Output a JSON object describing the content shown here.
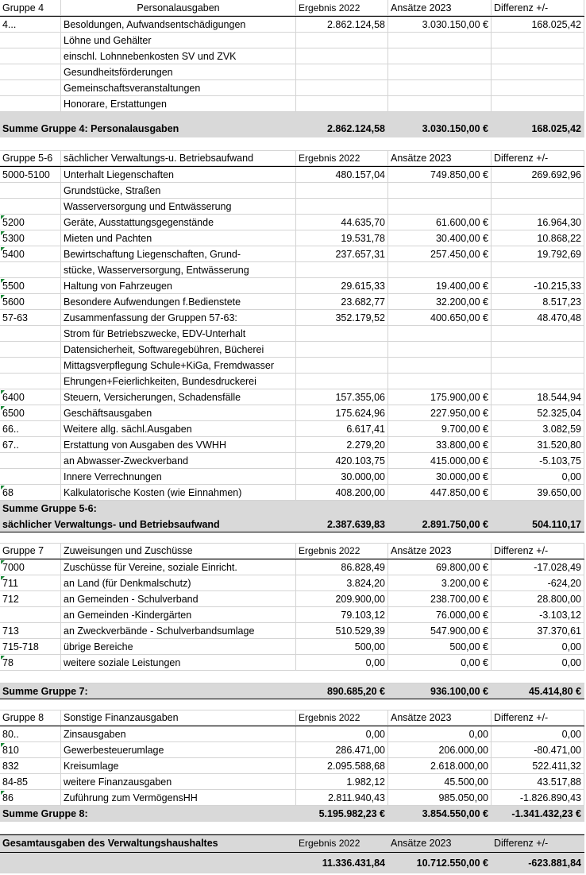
{
  "columns": {
    "ergebnis": "Ergebnis 2022",
    "ansaetze": "Ansätze 2023",
    "differenz": "Differenz +/-"
  },
  "g4": {
    "label": "Gruppe 4",
    "title": "Personalausgaben",
    "rows": [
      {
        "code": "4...",
        "desc": "Besoldungen, Aufwandsentschädigungen",
        "e": "2.862.124,58",
        "a": "3.030.150,00 €",
        "d": "168.025,42"
      },
      {
        "code": "",
        "desc": "Löhne und Gehälter",
        "e": "",
        "a": "",
        "d": ""
      },
      {
        "code": "",
        "desc": "einschl. Lohnnebenkosten SV und ZVK",
        "e": "",
        "a": "",
        "d": ""
      },
      {
        "code": "",
        "desc": "Gesundheitsförderungen",
        "e": "",
        "a": "",
        "d": ""
      },
      {
        "code": "",
        "desc": "Gemeinschaftsveranstaltungen",
        "e": "",
        "a": "",
        "d": ""
      },
      {
        "code": "",
        "desc": "Honorare, Erstattungen",
        "e": "",
        "a": "",
        "d": ""
      }
    ],
    "sum": {
      "label": "Summe Gruppe 4: Personalausgaben",
      "e": "2.862.124,58",
      "a": "3.030.150,00 €",
      "d": "168.025,42"
    }
  },
  "g56": {
    "label": "Gruppe 5-6",
    "title": "sächlicher Verwaltungs-u. Betriebsaufwand",
    "rows": [
      {
        "code": "5000-5100",
        "desc": "Unterhalt Liegenschaften",
        "e": "480.157,04",
        "a": "749.850,00 €",
        "d": "269.692,96"
      },
      {
        "code": "",
        "desc": "Grundstücke, Straßen",
        "e": "",
        "a": "",
        "d": ""
      },
      {
        "code": "",
        "desc": "Wasserversorgung und Entwässerung",
        "e": "",
        "a": "",
        "d": ""
      },
      {
        "code": "5200",
        "desc": "Geräte, Ausstattungsgegenstände",
        "e": "44.635,70",
        "a": "61.600,00 €",
        "d": "16.964,30"
      },
      {
        "code": "5300",
        "desc": "Mieten und Pachten",
        "e": "19.531,78",
        "a": "30.400,00 €",
        "d": "10.868,22"
      },
      {
        "code": "5400",
        "desc": "Bewirtschaftung Liegenschaften, Grund-",
        "e": "237.657,31",
        "a": "257.450,00 €",
        "d": "19.792,69"
      },
      {
        "code": "",
        "desc": "stücke, Wasserversorgung, Entwässerung",
        "e": "",
        "a": "",
        "d": ""
      },
      {
        "code": "5500",
        "desc": "Haltung von Fahrzeugen",
        "e": "29.615,33",
        "a": "19.400,00 €",
        "d": "-10.215,33"
      },
      {
        "code": "5600",
        "desc": "Besondere Aufwendungen f.Bedienstete",
        "e": "23.682,77",
        "a": "32.200,00 €",
        "d": "8.517,23"
      },
      {
        "code": "57-63",
        "desc": "Zusammenfassung der Gruppen 57-63:",
        "e": "352.179,52",
        "a": "400.650,00 €",
        "d": "48.470,48"
      },
      {
        "code": "",
        "desc": "Strom für Betriebszwecke, EDV-Unterhalt",
        "e": "",
        "a": "",
        "d": ""
      },
      {
        "code": "",
        "desc": "Datensicherheit, Softwaregebühren, Bücherei",
        "e": "",
        "a": "",
        "d": ""
      },
      {
        "code": "",
        "desc": "Mittagsverpflegung Schule+KiGa, Fremdwasser",
        "e": "",
        "a": "",
        "d": ""
      },
      {
        "code": "",
        "desc": "Ehrungen+Feierlichkeiten, Bundesdruckerei",
        "e": "",
        "a": "",
        "d": ""
      },
      {
        "code": "6400",
        "desc": "Steuern, Versicherungen, Schadensfälle",
        "e": "157.355,06",
        "a": "175.900,00 €",
        "d": "18.544,94"
      },
      {
        "code": "6500",
        "desc": "Geschäftsausgaben",
        "e": "175.624,96",
        "a": "227.950,00 €",
        "d": "52.325,04"
      },
      {
        "code": "66..",
        "desc": "Weitere allg. sächl.Ausgaben",
        "e": "6.617,41",
        "a": "9.700,00 €",
        "d": "3.082,59"
      },
      {
        "code": "67..",
        "desc": "Erstattung von Ausgaben des VWHH",
        "e": "2.279,20",
        "a": "33.800,00 €",
        "d": "31.520,80"
      },
      {
        "code": "",
        "desc": "an Abwasser-Zweckverband",
        "e": "420.103,75",
        "a": "415.000,00 €",
        "d": "-5.103,75"
      },
      {
        "code": "",
        "desc": "Innere Verrechnungen",
        "e": "30.000,00",
        "a": "30.000,00 €",
        "d": "0,00"
      },
      {
        "code": "68",
        "desc": "Kalkulatorische Kosten (wie Einnahmen)",
        "e": "408.200,00",
        "a": "447.850,00 €",
        "d": "39.650,00"
      }
    ],
    "sum_line1": "Summe Gruppe 5-6:",
    "sum": {
      "label": "sächlicher Verwaltungs- und Betriebsaufwand",
      "e": "2.387.639,83",
      "a": "2.891.750,00 €",
      "d": "504.110,17"
    }
  },
  "g7": {
    "label": "Gruppe 7",
    "title": "Zuweisungen und Zuschüsse",
    "rows": [
      {
        "code": "7000",
        "desc": "Zuschüsse für Vereine, soziale Einricht.",
        "e": "86.828,49",
        "a": "69.800,00 €",
        "d": "-17.028,49"
      },
      {
        "code": "711",
        "desc": "an Land (für Denkmalschutz)",
        "e": "3.824,20",
        "a": "3.200,00 €",
        "d": "-624,20"
      },
      {
        "code": "712",
        "desc": "an Gemeinden - Schulverband",
        "e": "209.900,00",
        "a": "238.700,00 €",
        "d": "28.800,00"
      },
      {
        "code": "",
        "desc": "an Gemeinden -Kindergärten",
        "e": "79.103,12",
        "a": "76.000,00 €",
        "d": "-3.103,12"
      },
      {
        "code": "713",
        "desc": "an Zweckverbände - Schulverbandsumlage",
        "e": "510.529,39",
        "a": "547.900,00 €",
        "d": "37.370,61"
      },
      {
        "code": "715-718",
        "desc": "übrige Bereiche",
        "e": "500,00",
        "a": "500,00 €",
        "d": "0,00"
      },
      {
        "code": "78",
        "desc": "weitere soziale Leistungen",
        "e": "0,00",
        "a": "0,00 €",
        "d": "0,00"
      }
    ],
    "sum": {
      "label": "Summe Gruppe 7:",
      "e": "890.685,20 €",
      "a": "936.100,00 €",
      "d": "45.414,80 €"
    }
  },
  "g8": {
    "label": "Gruppe 8",
    "title": "Sonstige Finanzausgaben",
    "rows": [
      {
        "code": "80..",
        "desc": "Zinsausgaben",
        "e": "0,00",
        "a": "0,00",
        "d": "0,00"
      },
      {
        "code": "810",
        "desc": "Gewerbesteuerumlage",
        "e": "286.471,00",
        "a": "206.000,00",
        "d": "-80.471,00"
      },
      {
        "code": "832",
        "desc": "Kreisumlage",
        "e": "2.095.588,68",
        "a": "2.618.000,00",
        "d": "522.411,32"
      },
      {
        "code": "84-85",
        "desc": "weitere Finanzausgaben",
        "e": "1.982,12",
        "a": "45.500,00",
        "d": "43.517,88"
      },
      {
        "code": "86",
        "desc": "Zuführung zum VermögensHH",
        "e": "2.811.940,43",
        "a": "985.050,00",
        "d": "-1.826.890,43"
      }
    ],
    "sum": {
      "label": "Summe Gruppe 8:",
      "e": "5.195.982,23 €",
      "a": "3.854.550,00 €",
      "d": "-1.341.432,23 €"
    }
  },
  "total": {
    "label": "Gesamtausgaben des Verwaltungshaushaltes",
    "e": "11.336.431,84",
    "a": "10.712.550,00 €",
    "d": "-623.881,84"
  }
}
